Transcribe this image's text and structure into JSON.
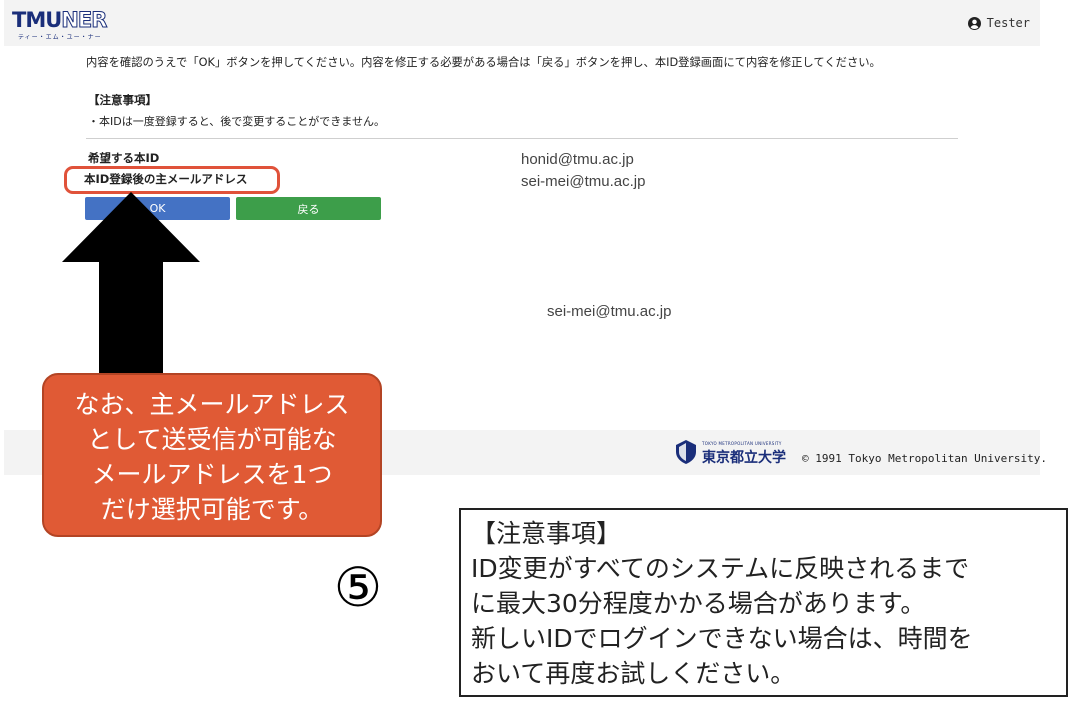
{
  "header": {
    "logo_text": "TMUNER",
    "logo_subtitle": "ティー・エム・ユー・ナー",
    "user_name": "Tester",
    "user_icon": "user-circle-icon"
  },
  "confirm": {
    "instruction": "内容を確認のうえで「OK」ボタンを押してください。内容を修正する必要がある場合は「戻る」ボタンを押し、本ID登録画面にて内容を修正してください。",
    "notes_heading": "【注意事項】",
    "notes_body": "・本IDは一度登録すると、後で変更することができません。",
    "label_desired_id": "希望する本ID",
    "label_main_mail": "本ID登録後の主メールアドレス",
    "value_desired_id": "honid@tmu.ac.jp",
    "value_main_mail": "sei-mei@tmu.ac.jp",
    "value_main_mail_repeat": "sei-mei@tmu.ac.jp",
    "ok_button": "OK",
    "back_button": "戻る"
  },
  "footer": {
    "university_small": "TOKYO METROPOLITAN UNIVERSITY",
    "university_name": "東京都立大学",
    "copyright": "© 1991 Tokyo Metropolitan University."
  },
  "annotation": {
    "callout_lines": [
      "なお、主メールアドレス",
      "として送受信が可能な",
      "メールアドレスを1つ",
      "だけ選択可能です。"
    ],
    "step_number": "⑤",
    "notice_lines": [
      "【注意事項】",
      "ID変更がすべてのシステムに反映されるまで",
      "に最大30分程度かかる場合があります。",
      "新しいIDでログインできない場合は、時間を",
      "おいて再度お試しください。"
    ],
    "colors": {
      "callout": "#e05a35",
      "highlight": "#e0523a",
      "arrow": "#000000"
    }
  },
  "colors": {
    "ok_button": "#4472c4",
    "back_button": "#3d9e4a",
    "brand": "#1a2e7a"
  }
}
